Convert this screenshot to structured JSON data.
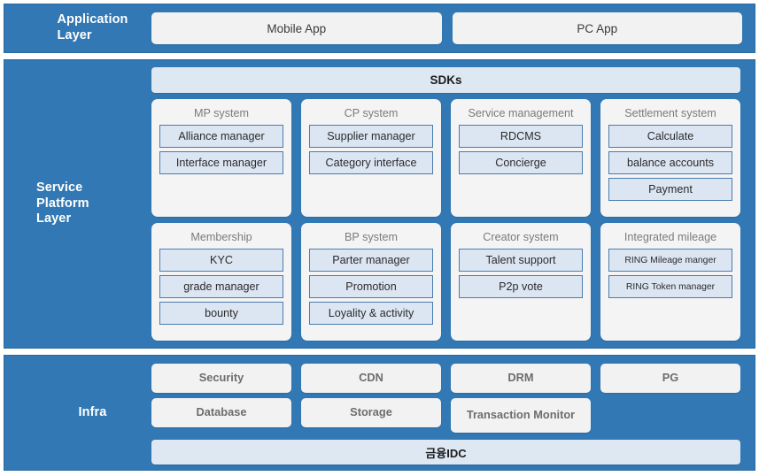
{
  "colors": {
    "band_blue": "#3178b4",
    "card_gray": "#f4f4f4",
    "sub_item_fill": "#dce5f2",
    "sub_item_border": "#4a7cb0",
    "bar_light_blue": "#dee8f3"
  },
  "layers": {
    "application": {
      "label_line1": "Application",
      "label_line2": "Layer",
      "boxes": [
        {
          "label": "Mobile App"
        },
        {
          "label": "PC App"
        }
      ]
    },
    "service_platform": {
      "label_line1": "Service",
      "label_line2": "Platform",
      "label_line3": "Layer",
      "sdk_bar": "SDKs",
      "row1": [
        {
          "title": "MP system",
          "items": [
            {
              "label": "Alliance manager",
              "small": false
            },
            {
              "label": "Interface manager",
              "small": false
            }
          ]
        },
        {
          "title": "CP system",
          "items": [
            {
              "label": "Supplier manager",
              "small": false
            },
            {
              "label": "Category interface",
              "small": false
            }
          ]
        },
        {
          "title": "Service management",
          "items": [
            {
              "label": "RDCMS",
              "small": false
            },
            {
              "label": "Concierge",
              "small": false
            }
          ]
        },
        {
          "title": "Settlement system",
          "items": [
            {
              "label": "Calculate",
              "small": false
            },
            {
              "label": "balance accounts",
              "small": false
            },
            {
              "label": "Payment",
              "small": false
            }
          ]
        }
      ],
      "row2": [
        {
          "title": "Membership",
          "items": [
            {
              "label": "KYC",
              "small": false
            },
            {
              "label": "grade manager",
              "small": false
            },
            {
              "label": "bounty",
              "small": false
            }
          ]
        },
        {
          "title": "BP system",
          "items": [
            {
              "label": "Parter manager",
              "small": false
            },
            {
              "label": "Promotion",
              "small": false
            },
            {
              "label": "Loyality & activity",
              "small": false
            }
          ]
        },
        {
          "title": "Creator system",
          "items": [
            {
              "label": "Talent support",
              "small": false
            },
            {
              "label": "P2p vote",
              "small": false
            }
          ]
        },
        {
          "title": "Integrated mileage",
          "items": [
            {
              "label": "RING Mileage manger",
              "small": true
            },
            {
              "label": "RING Token manager",
              "small": true
            }
          ]
        }
      ]
    },
    "infra": {
      "label_line1": "Infra",
      "columns": [
        {
          "top": "Security",
          "bottom": "Database",
          "bottom_present": true,
          "bottom_tall": false
        },
        {
          "top": "CDN",
          "bottom": "Storage",
          "bottom_present": true,
          "bottom_tall": false
        },
        {
          "top": "DRM",
          "bottom": "Transaction Monitor",
          "bottom_present": true,
          "bottom_tall": true
        },
        {
          "top": "PG",
          "bottom": "",
          "bottom_present": false,
          "bottom_tall": false
        }
      ],
      "idc_bar": "금융IDC"
    }
  }
}
